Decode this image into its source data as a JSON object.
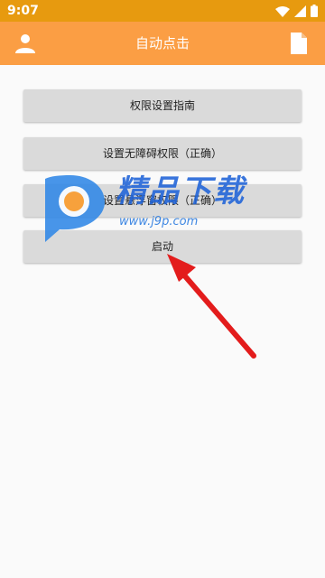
{
  "status_bar": {
    "time": "9:07"
  },
  "app_bar": {
    "title": "自动点击",
    "left_icon": "user-icon",
    "right_icon": "file-icon",
    "color": "#fb9e44"
  },
  "buttons": [
    {
      "label": "权限设置指南"
    },
    {
      "label": "设置无障碍权限（正确）"
    },
    {
      "label": "设置悬浮窗权限（正确）"
    },
    {
      "label": "启动"
    }
  ],
  "watermark": {
    "text": "精品下载",
    "url": "www.j9p.com"
  },
  "colors": {
    "status_bar": "#e79a0f",
    "button": "#dadada",
    "arrow": "#e31c1c"
  }
}
